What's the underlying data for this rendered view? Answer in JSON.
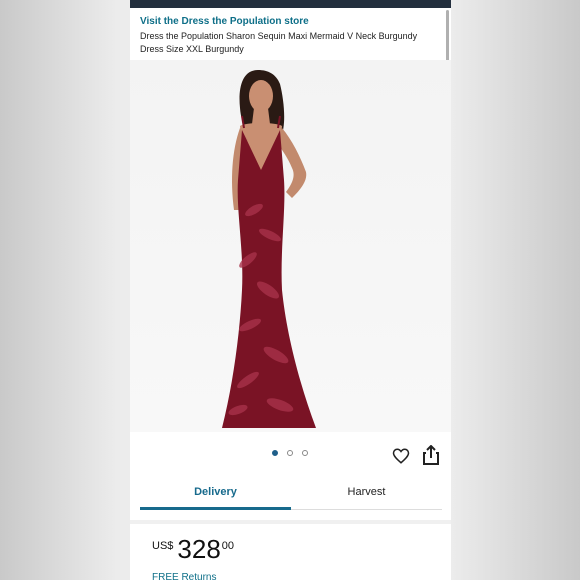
{
  "store_link": "Visit the Dress the Population store",
  "product_title": "Dress the Population Sharon Sequin Maxi Mermaid V Neck Burgundy Dress Size XXL Burgundy",
  "carousel": {
    "count": 3,
    "active_index": 0
  },
  "icons": {
    "favorite": "heart-icon",
    "share": "share-icon"
  },
  "tabs": [
    {
      "label": "Delivery",
      "active": true
    },
    {
      "label": "Harvest",
      "active": false
    }
  ],
  "price": {
    "currency": "US$",
    "whole": "328",
    "fraction": "00"
  },
  "returns": "FREE Returns",
  "colors": {
    "accent": "#176a8c",
    "dress": "#7a1325",
    "header": "#232f3e"
  }
}
